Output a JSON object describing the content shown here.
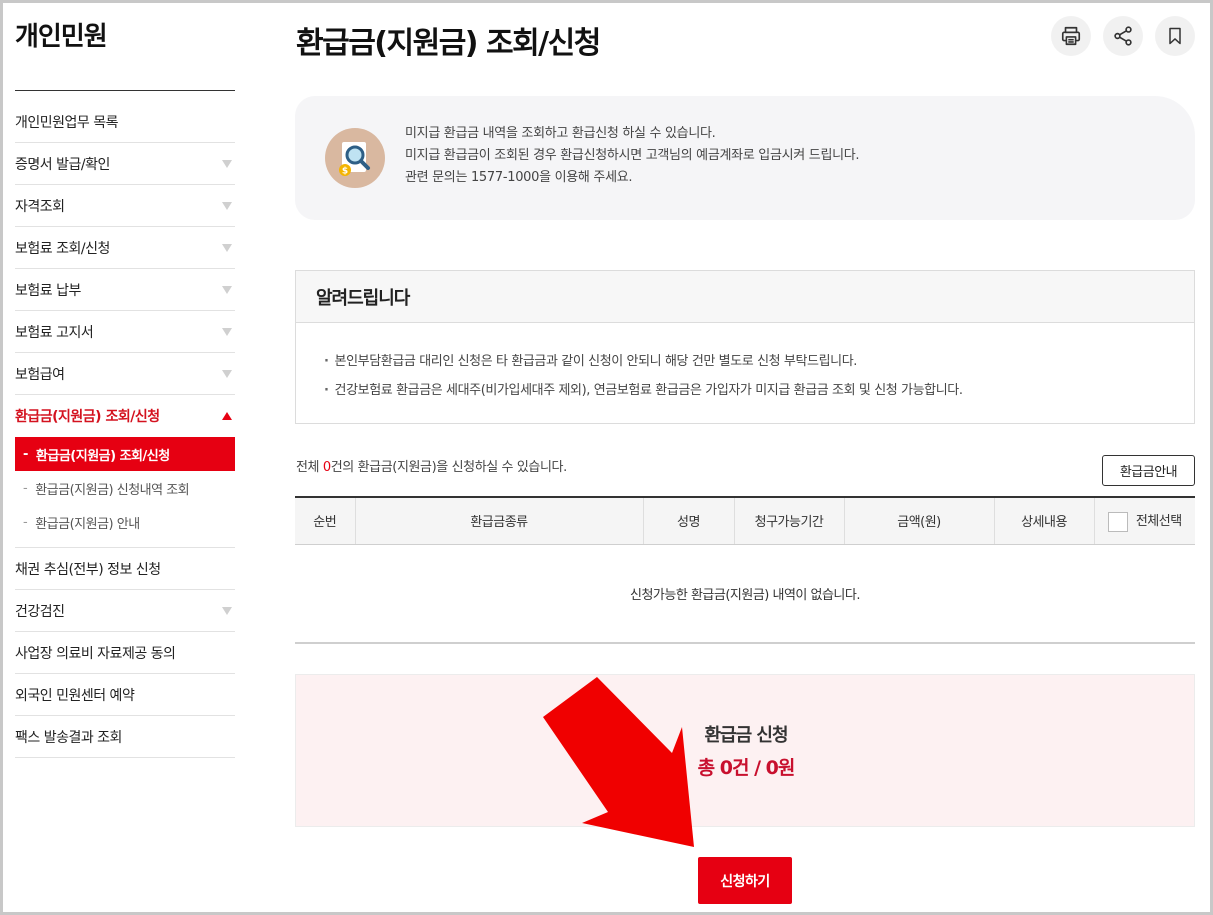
{
  "sidebar": {
    "title": "개인민원",
    "items": [
      {
        "label": "개인민원업무 목록",
        "arrow": false
      },
      {
        "label": "증명서 발급/확인",
        "arrow": true
      },
      {
        "label": "자격조회",
        "arrow": true
      },
      {
        "label": "보험료 조회/신청",
        "arrow": true
      },
      {
        "label": "보험료 납부",
        "arrow": true
      },
      {
        "label": "보험료 고지서",
        "arrow": true
      },
      {
        "label": "보험급여",
        "arrow": true
      },
      {
        "label": "환급금(지원금) 조회/신청",
        "arrow": true,
        "active": true
      },
      {
        "label": "채권 추심(전부) 정보 신청",
        "arrow": false
      },
      {
        "label": "건강검진",
        "arrow": true
      },
      {
        "label": "사업장 의료비 자료제공 동의",
        "arrow": false
      },
      {
        "label": "외국인 민원센터 예약",
        "arrow": false
      },
      {
        "label": "팩스 발송결과 조회",
        "arrow": false
      }
    ],
    "submenu": [
      {
        "label": "환급금(지원금) 조회/신청",
        "selected": true
      },
      {
        "label": "환급금(지원금) 신청내역 조회",
        "selected": false
      },
      {
        "label": "환급금(지원금) 안내",
        "selected": false
      }
    ]
  },
  "header": {
    "title": "환급금(지원금) 조회/신청",
    "tools": [
      {
        "name": "print-icon"
      },
      {
        "name": "share-icon"
      },
      {
        "name": "bookmark-icon"
      }
    ]
  },
  "intro": {
    "icon": "search-money-icon",
    "lines": [
      "미지급 환급금 내역을 조회하고 환급신청 하실 수 있습니다.",
      "미지급 환급금이 조회된 경우 환급신청하시면 고객님의 예금계좌로 입금시켜 드립니다.",
      "관련 문의는 1577-1000을 이용해 주세요."
    ]
  },
  "notice": {
    "title": "알려드립니다",
    "items": [
      "본인부담환급금 대리인 신청은 타 환급금과 같이 신청이 안되니 해당 건만 별도로 신청 부탁드립니다.",
      "건강보험료 환급금은 세대주(비가입세대주 제외), 연금보험료 환급금은 가입자가 미지급 환급금 조회 및 신청 가능합니다."
    ]
  },
  "summary": {
    "prefix": "전체 ",
    "count": "0",
    "suffix": "건의 환급금(지원금)을 신청하실 수 있습니다.",
    "guide_button": "환급금안내"
  },
  "table": {
    "headers": [
      "순번",
      "환급금종류",
      "성명",
      "청구가능기간",
      "금액(원)",
      "상세내용"
    ],
    "select_all": "전체선택",
    "empty_message": "신청가능한 환급금(지원금) 내역이 없습니다."
  },
  "apply": {
    "title": "환급금 신청",
    "total": "총 0건 / 0원",
    "submit_label": "신청하기"
  },
  "colors": {
    "accent": "#e60012",
    "total_text": "#c8102e",
    "apply_bg": "#fdf1f2"
  }
}
